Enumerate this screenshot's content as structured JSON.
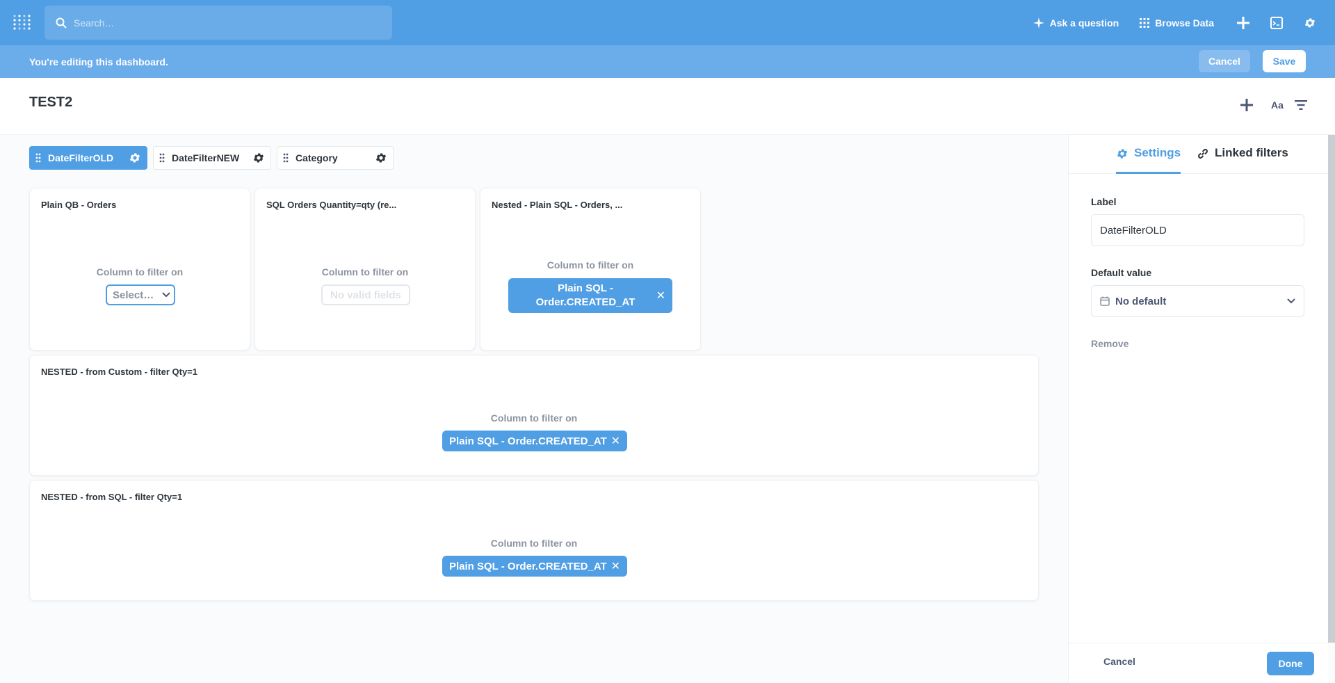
{
  "nav": {
    "search_placeholder": "Search…",
    "ask_question": "Ask a question",
    "browse_data": "Browse Data"
  },
  "editbar": {
    "message": "You're editing this dashboard.",
    "cancel": "Cancel",
    "save": "Save"
  },
  "dashboard": {
    "title": "TEST2"
  },
  "filters": [
    {
      "label": "DateFilterOLD",
      "active": true
    },
    {
      "label": "DateFilterNEW",
      "active": false
    },
    {
      "label": "Category",
      "active": false
    }
  ],
  "cards": {
    "c1": {
      "title": "Plain QB - Orders",
      "column_label": "Column to filter on",
      "select": "Select…"
    },
    "c2": {
      "title": "SQL Orders Quantity=qty (re...",
      "column_label": "Column to filter on",
      "no_valid": "No valid fields"
    },
    "c3": {
      "title": "Nested - Plain SQL - Orders, ...",
      "column_label": "Column to filter on",
      "chip_line1": "Plain SQL -",
      "chip_line2": "Order.CREATED_AT"
    },
    "c4": {
      "title": "NESTED - from Custom - filter Qty=1",
      "column_label": "Column to filter on",
      "chip": "Plain SQL - Order.CREATED_AT"
    },
    "c5": {
      "title": "NESTED - from SQL - filter Qty=1",
      "column_label": "Column to filter on",
      "chip": "Plain SQL - Order.CREATED_AT"
    }
  },
  "sidebar": {
    "tab_settings": "Settings",
    "tab_linked": "Linked filters",
    "label_label": "Label",
    "label_value": "DateFilterOLD",
    "default_label": "Default value",
    "default_value": "No default",
    "remove": "Remove",
    "cancel": "Cancel",
    "done": "Done"
  },
  "colors": {
    "brand": "#509ee3",
    "editbar": "#6bacea",
    "text_dark": "#2e353b",
    "text_medium": "#8b93a0"
  }
}
